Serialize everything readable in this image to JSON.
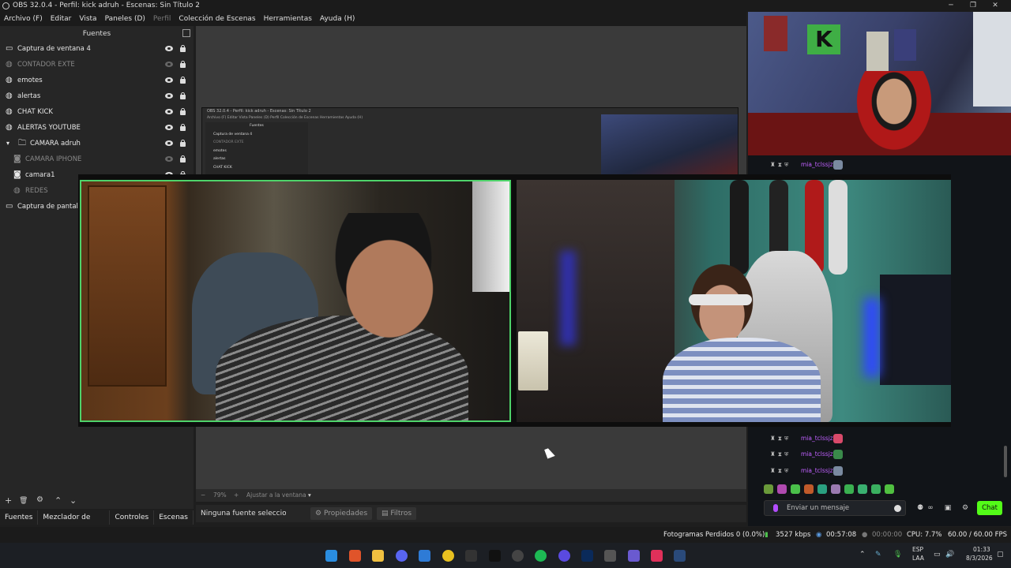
{
  "window": {
    "title": "OBS 32.0.4 - Perfil: kick adruh - Escenas: Sin Título 2",
    "minimize": "─",
    "restore": "❐",
    "close": "✕"
  },
  "menu": [
    "Archivo (F)",
    "Editar",
    "Vista",
    "Paneles (D)",
    "Perfil",
    "Colección de Escenas",
    "Herramientas",
    "Ayuda (H)"
  ],
  "sources": {
    "header": "Fuentes",
    "items": [
      {
        "label": "Captura de ventana 4",
        "icon": "window-capture-icon",
        "visible": true,
        "dim": false
      },
      {
        "label": "CONTADOR EXTE",
        "icon": "browser-source-icon",
        "visible": false,
        "dim": true
      },
      {
        "label": "emotes",
        "icon": "browser-source-icon",
        "visible": true,
        "dim": false
      },
      {
        "label": "alertas",
        "icon": "browser-source-icon",
        "visible": true,
        "dim": false
      },
      {
        "label": "CHAT KICK",
        "icon": "browser-source-icon",
        "visible": true,
        "dim": false
      },
      {
        "label": "ALERTAS YOUTUBE",
        "icon": "browser-source-icon",
        "visible": true,
        "dim": false
      },
      {
        "label": "CAMARA adruh",
        "icon": "folder-icon",
        "visible": true,
        "dim": false
      },
      {
        "label": "CAMARA IPHONE",
        "icon": "camera-icon",
        "visible": false,
        "dim": true
      },
      {
        "label": "camara1",
        "icon": "camera-icon",
        "visible": true,
        "dim": false
      },
      {
        "label": "REDES",
        "icon": "browser-source-icon",
        "visible": false,
        "dim": true
      },
      {
        "label": "Captura de pantalla",
        "icon": "display-capture-icon",
        "visible": true,
        "dim": false
      }
    ]
  },
  "source_toolbar": {
    "add": "+",
    "remove": "🗑",
    "settings": "⚙",
    "up": "⌃",
    "down": "⌄"
  },
  "dock_tabs": [
    "Fuentes",
    "Mezclador de audio",
    "Controles",
    "Escenas"
  ],
  "preview_bar": {
    "zoom_out": "−",
    "zoom": "79%",
    "zoom_in": "+",
    "fit": "Ajustar a la ventana"
  },
  "context_bar": {
    "no_source": "Ninguna fuente seleccionada",
    "properties": "Propiedades",
    "filters": "Filtros"
  },
  "status": {
    "dropped": "Fotogramas Perdidos 0 (0.0%)",
    "bitrate": "3527 kbps",
    "stream_time": "00:57:08",
    "rec_time": "00:00:00",
    "cpu": "CPU: 7.7%",
    "fps": "60.00 / 60.00 FPS"
  },
  "chat": {
    "messages": [
      {
        "user": "mia_tclssjz",
        "emote_color": "#7a8aa0"
      },
      {
        "user": "mia_tclssjz",
        "emote_color": "#d94a6a"
      },
      {
        "user": "mia_tclssjz",
        "emote_color": "#3a8a4a"
      },
      {
        "user": "mia_tclssjz",
        "emote_color": "#7a8aa0"
      }
    ],
    "placeholder": "Enviar un mensaje",
    "send": "Chat"
  },
  "nested": {
    "title": "OBS 32.0.4 - Perfil: kick adruh - Escenas: Sin Título 2",
    "menu": "Archivo (F)  Editar  Vista  Paneles (D)  Perfil  Colección de Escenas  Herramientas  Ayuda (H)",
    "header": "Fuentes",
    "items": [
      "Captura de ventana 4",
      "CONTADOR EXTE",
      "emotes",
      "alertas",
      "CHAT KICK"
    ]
  },
  "camera_poster_letter": "K",
  "tray": {
    "lang_top": "ESP",
    "lang_bottom": "LAA",
    "time": "01:33",
    "date": "8/3/2026"
  },
  "colors": {
    "accent_green": "#53fc18",
    "username": "#c060ff",
    "cam_border": "#4ed36a"
  }
}
